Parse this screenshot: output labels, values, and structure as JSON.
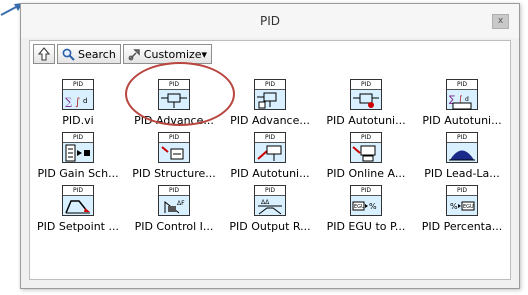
{
  "window": {
    "title": "PID",
    "close_glyph": "x"
  },
  "toolbar": {
    "up_icon": "up-arrow-icon",
    "search_label": "Search",
    "customize_label": "Customize▾"
  },
  "palette_items": [
    {
      "label": "PID.vi",
      "band": "PID",
      "icon": "pid-icon"
    },
    {
      "label": "PID Advance...",
      "band": "PID",
      "icon": "pid-advanced-icon"
    },
    {
      "label": "PID Advance...",
      "band": "PID",
      "icon": "pid-advanced-array-icon"
    },
    {
      "label": "PID Autotuni...",
      "band": "PID",
      "icon": "pid-autotuning-icon"
    },
    {
      "label": "PID Autotuni...",
      "band": "PID",
      "icon": "pid-autotuning-design-icon"
    },
    {
      "label": "PID Gain Sch...",
      "band": "PID",
      "icon": "pid-gain-schedule-icon"
    },
    {
      "label": "PID Structure...",
      "band": "PID",
      "icon": "pid-structure-icon"
    },
    {
      "label": "PID Autotuni...",
      "band": "PID",
      "icon": "pid-autotuning-temp-icon"
    },
    {
      "label": "PID Online A...",
      "band": "PID",
      "icon": "pid-online-icon"
    },
    {
      "label": "PID Lead-La...",
      "band": "PID",
      "icon": "pid-lead-lag-icon"
    },
    {
      "label": "PID Setpoint ...",
      "band": "PID",
      "icon": "pid-setpoint-icon"
    },
    {
      "label": "PID Control I...",
      "band": "PID",
      "icon": "pid-control-input-icon"
    },
    {
      "label": "PID Output R...",
      "band": "PID",
      "icon": "pid-output-rate-icon"
    },
    {
      "label": "PID EGU to P...",
      "band": "PID",
      "icon": "pid-egu-to-percent-icon"
    },
    {
      "label": "PID Percenta...",
      "band": "PID",
      "icon": "pid-percent-to-egu-icon"
    }
  ],
  "colors": {
    "highlight": "#b8453e",
    "pointer": "#3a6fb0",
    "icon_body": "#d8f0ff"
  }
}
